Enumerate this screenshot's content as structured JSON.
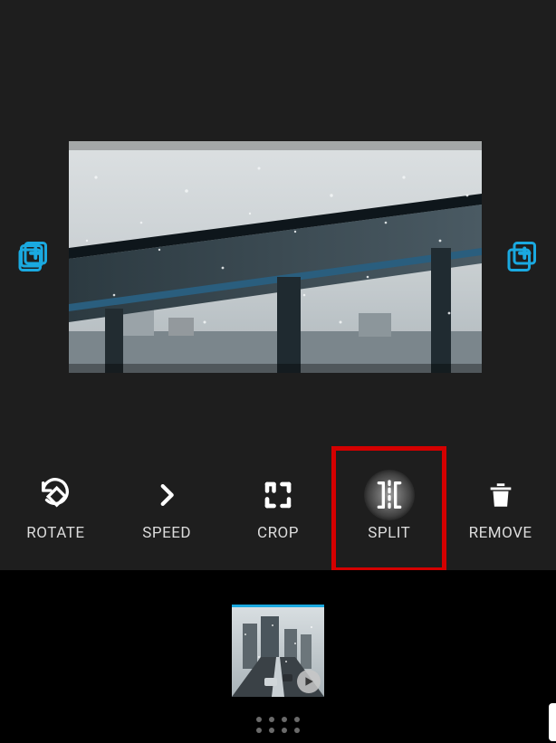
{
  "accent_color": "#1aa9e0",
  "highlight_color": "#d40000",
  "add_clip": {
    "left_label": "Add clip before",
    "right_label": "Add clip after"
  },
  "toolbar": {
    "rotate_label": "ROTATE",
    "speed_label": "SPEED",
    "crop_label": "CROP",
    "split_label": "SPLIT",
    "remove_label": "REMOVE",
    "highlighted": "split"
  },
  "timeline": {
    "clip_count": 1,
    "selected_index": 0,
    "clip_type": "video"
  }
}
